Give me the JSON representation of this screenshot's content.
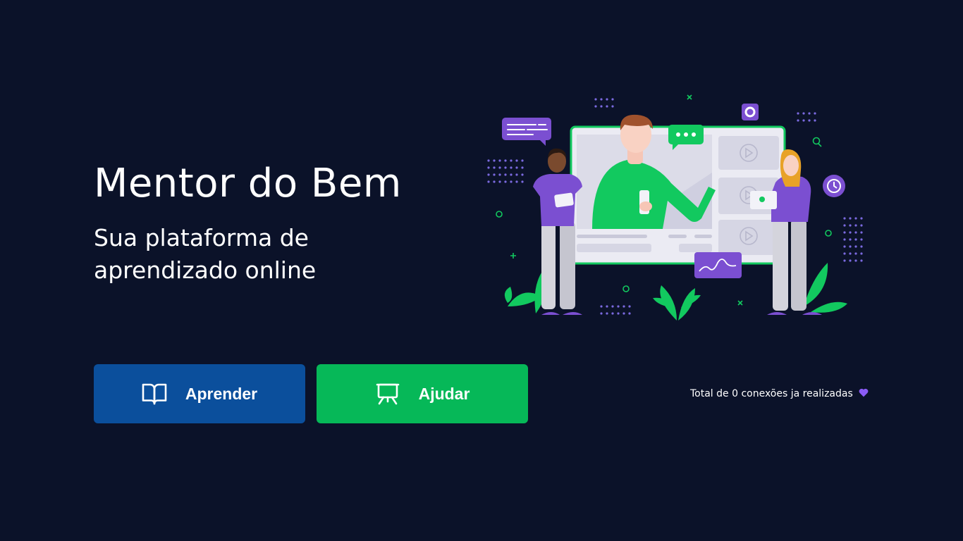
{
  "hero": {
    "title": "Mentor do Bem",
    "subtitle": "Sua plataforma de aprendizado online"
  },
  "buttons": {
    "learn": {
      "label": "Aprender",
      "icon": "book-open-icon"
    },
    "help": {
      "label": "Ajudar",
      "icon": "presentation-board-icon"
    }
  },
  "footer": {
    "connections_text": "Total de 0 conexões ja realizadas",
    "heart_icon": "purple-heart-icon"
  },
  "colors": {
    "background": "#0b1229",
    "learn_button": "#0b4f9c",
    "help_button": "#06b858",
    "accent_purple": "#7b4fd1",
    "accent_green": "#12c95f"
  }
}
